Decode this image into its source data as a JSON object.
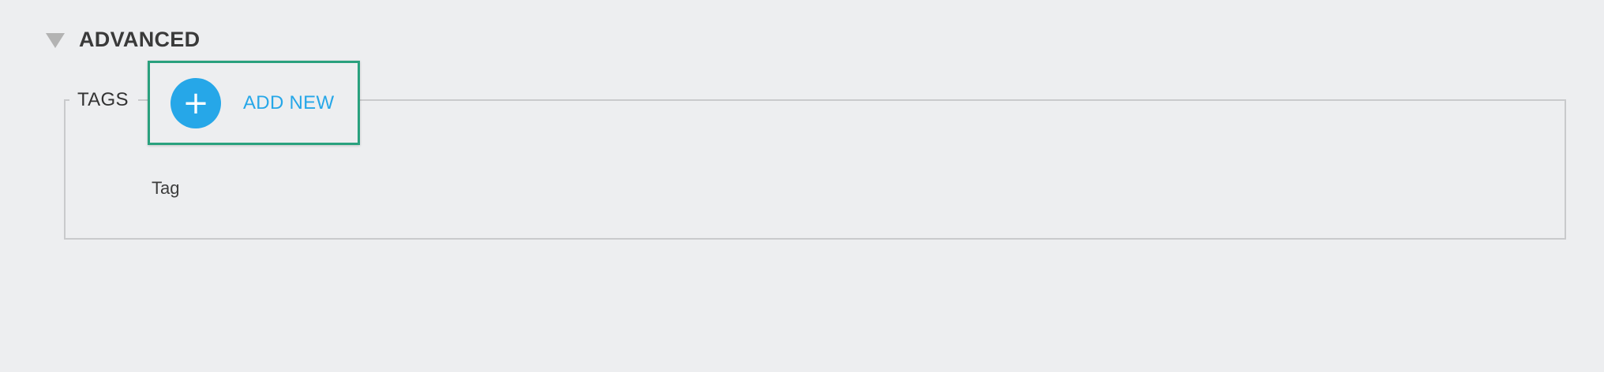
{
  "section": {
    "title": "ADVANCED",
    "caret_icon": "triangle-down-icon",
    "caret_color": "#b3b3b3"
  },
  "tags_group": {
    "legend": "TAGS",
    "add_button": {
      "icon": "plus-icon",
      "icon_glyph": "+",
      "label": "ADD NEW",
      "accent_color": "#26a7e8",
      "highlight_color": "#2aa17e"
    },
    "field_label": "Tag"
  }
}
